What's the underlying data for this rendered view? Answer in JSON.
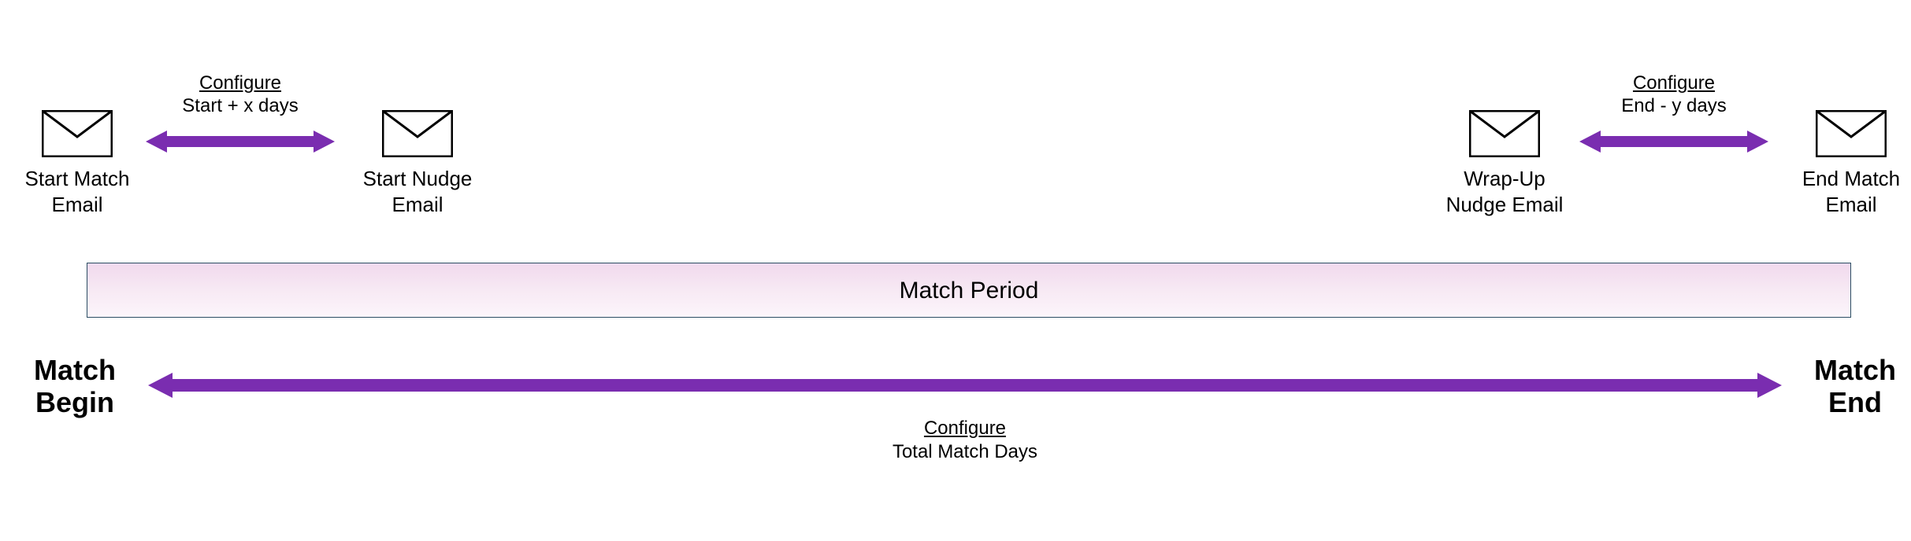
{
  "emails": {
    "start_match": {
      "line1": "Start Match",
      "line2": "Email"
    },
    "start_nudge": {
      "line1": "Start Nudge",
      "line2": "Email"
    },
    "wrapup_nudge": {
      "line1": "Wrap-Up",
      "line2": "Nudge Email"
    },
    "end_match": {
      "line1": "End Match",
      "line2": "Email"
    }
  },
  "configs": {
    "start": {
      "head": "Configure",
      "sub": "Start + x days"
    },
    "end": {
      "head": "Configure",
      "sub": "End - y days"
    },
    "total": {
      "head": "Configure",
      "sub": "Total Match Days"
    }
  },
  "period_label": "Match Period",
  "match_begin": {
    "line1": "Match",
    "line2": "Begin"
  },
  "match_end": {
    "line1": "Match",
    "line2": "End"
  },
  "colors": {
    "purple": "#7a2db0"
  }
}
